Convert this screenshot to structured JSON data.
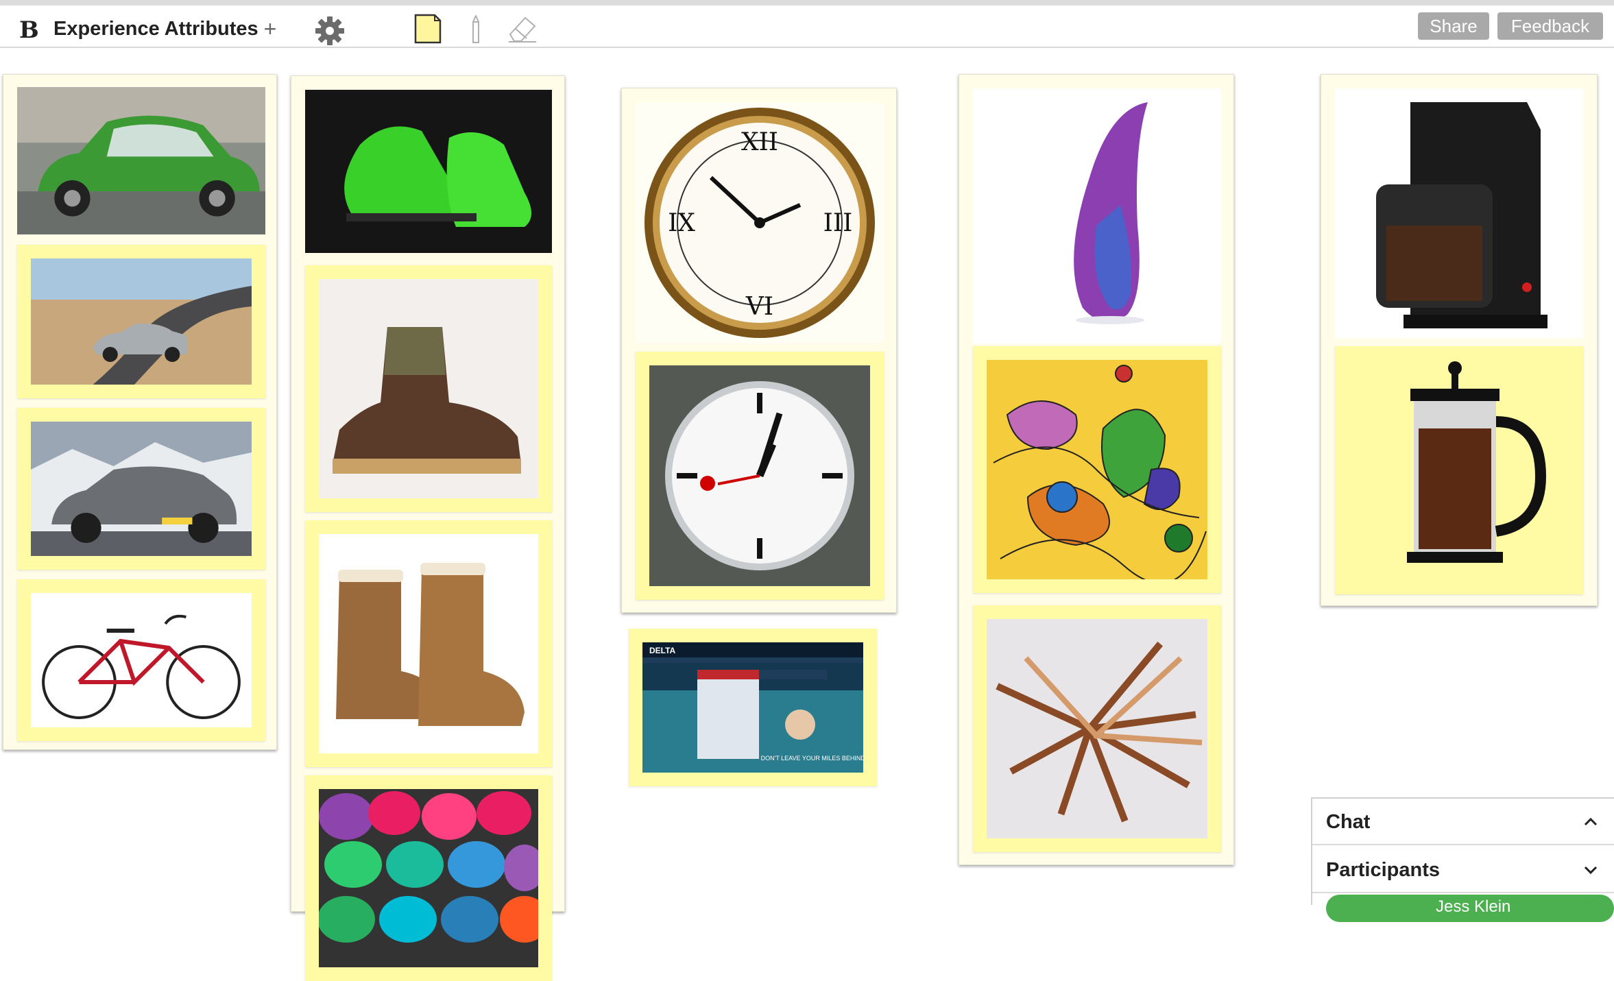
{
  "app": {
    "logo_text": "B",
    "board_title": "Experience Attributes",
    "add_label": "+"
  },
  "toolbar": {
    "share_label": "Share",
    "feedback_label": "Feedback",
    "icons": [
      "gear-icon",
      "sticky-note-icon",
      "pen-icon",
      "eraser-icon"
    ],
    "note_color": "#fff59d",
    "button_color": "#a9a9a9"
  },
  "board": {
    "columns": [
      {
        "name": "cars",
        "items": [
          "green-beetle-car",
          "silver-sedan-road",
          "gray-suv-snow",
          "red-cruiser-bicycle"
        ]
      },
      {
        "name": "footwear",
        "items": [
          "green-sneakers",
          "brown-work-boot",
          "tan-sheepskin-boots",
          "colorful-clogs"
        ]
      },
      {
        "name": "clocks",
        "items": [
          "antique-wall-clock",
          "station-clock",
          "delta-website-screenshot"
        ]
      },
      {
        "name": "art",
        "items": [
          "purple-glass-vase",
          "abstract-drawing",
          "wooden-spiral-sculpture"
        ]
      },
      {
        "name": "coffee",
        "items": [
          "coffee-maker",
          "french-press"
        ]
      }
    ]
  },
  "website_shot": {
    "brand": "DELTA",
    "headline": "DON'T LEAVE YOUR MILES BEHIND."
  },
  "sidebar": {
    "chat_label": "Chat",
    "participants_label": "Participants",
    "participant": "Jess Klein"
  }
}
